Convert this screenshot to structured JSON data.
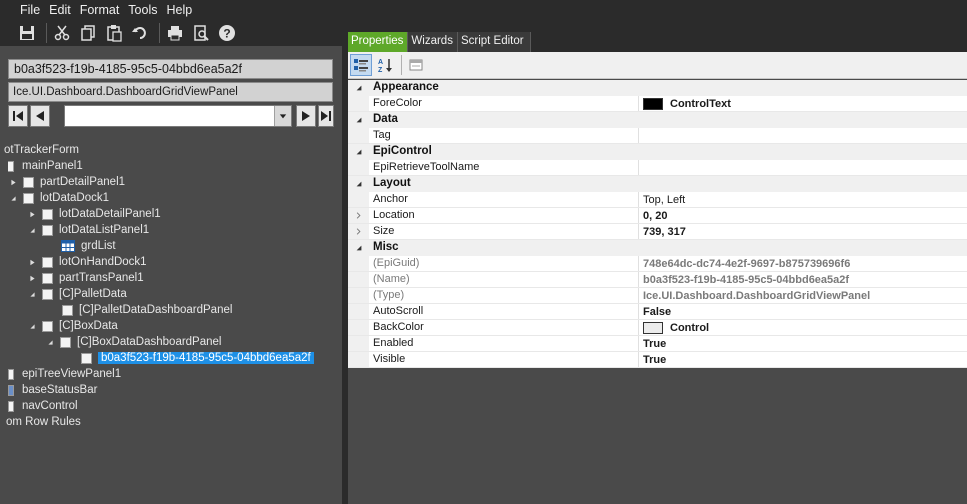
{
  "menu": [
    "File",
    "Edit",
    "Format",
    "Tools",
    "Help"
  ],
  "toolbar_icons": [
    "save-icon",
    "cut-icon",
    "copy-icon",
    "paste-icon",
    "undo-icon",
    "print-icon",
    "print-preview-icon",
    "help-icon"
  ],
  "left": {
    "selected_guid": "b0a3f523-f19b-4185-95c5-04bbd6ea5a2f",
    "selected_type": "Ice.UI.Dashboard.DashboardGridViewPanel",
    "tree": [
      {
        "label": "otTrackerForm"
      },
      {
        "label": "mainPanel1"
      },
      {
        "label": "partDetailPanel1"
      },
      {
        "label": "lotDataDock1"
      },
      {
        "label": "lotDataDetailPanel1"
      },
      {
        "label": "lotDataListPanel1"
      },
      {
        "label": "grdList"
      },
      {
        "label": "lotOnHandDock1"
      },
      {
        "label": "partTransPanel1"
      },
      {
        "label": "[C]PalletData"
      },
      {
        "label": "[C]PalletDataDashboardPanel"
      },
      {
        "label": "[C]BoxData"
      },
      {
        "label": "[C]BoxDataDashboardPanel"
      },
      {
        "label": "b0a3f523-f19b-4185-95c5-04bbd6ea5a2f"
      },
      {
        "label": "epiTreeViewPanel1"
      },
      {
        "label": "baseStatusBar"
      },
      {
        "label": "navControl"
      },
      {
        "label": "om Row Rules"
      }
    ]
  },
  "right": {
    "tabs": [
      "Properties",
      "Wizards",
      "Script Editor"
    ],
    "categories": [
      {
        "name": "Appearance",
        "props": [
          {
            "name": "ForeColor",
            "value": "ControlText",
            "swatch": "#000000",
            "bold": true
          }
        ]
      },
      {
        "name": "Data",
        "props": [
          {
            "name": "Tag",
            "value": ""
          }
        ]
      },
      {
        "name": "EpiControl",
        "props": [
          {
            "name": "EpiRetrieveToolName",
            "value": ""
          }
        ]
      },
      {
        "name": "Layout",
        "props": [
          {
            "name": "Anchor",
            "value": "Top, Left"
          },
          {
            "name": "Location",
            "value": "0, 20",
            "bold": true,
            "expandable": true
          },
          {
            "name": "Size",
            "value": "739, 317",
            "bold": true,
            "expandable": true
          }
        ]
      },
      {
        "name": "Misc",
        "props": [
          {
            "name": "(EpiGuid)",
            "value": "748e64dc-dc74-4e2f-9697-b875739696f6",
            "readonly": true,
            "bold": true
          },
          {
            "name": "(Name)",
            "value": "b0a3f523-f19b-4185-95c5-04bbd6ea5a2f",
            "readonly": true,
            "bold": true
          },
          {
            "name": "(Type)",
            "value": "Ice.UI.Dashboard.DashboardGridViewPanel",
            "readonly": true,
            "bold": true
          },
          {
            "name": "AutoScroll",
            "value": "False",
            "bold": true
          },
          {
            "name": "BackColor",
            "value": "Control",
            "swatch": "#ececec",
            "bold": true
          },
          {
            "name": "Enabled",
            "value": "True",
            "bold": true
          },
          {
            "name": "Visible",
            "value": "True",
            "bold": true
          }
        ]
      }
    ]
  }
}
